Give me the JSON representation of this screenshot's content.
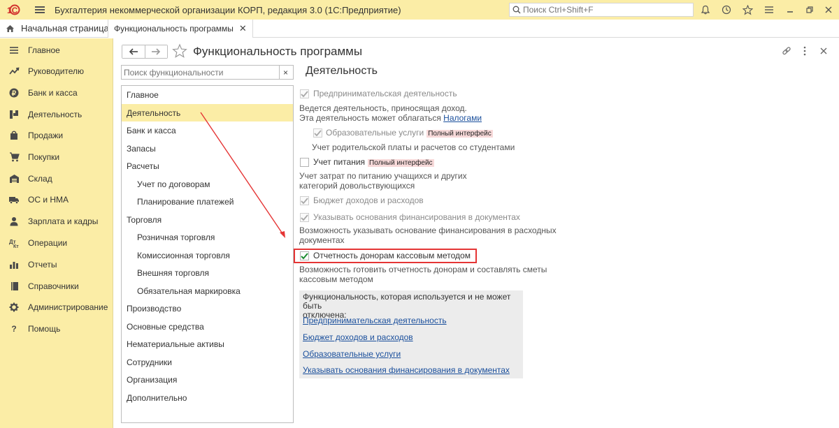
{
  "titlebar": {
    "logo": "1С",
    "app_title": "Бухгалтерия некоммерческой организации КОРП, редакция 3.0  (1С:Предприятие)",
    "search_placeholder": "Поиск Ctrl+Shift+F",
    "icons": [
      "bell-icon",
      "history-icon",
      "star-icon",
      "menu-lines-icon",
      "minimize-icon",
      "restore-icon",
      "close-icon"
    ]
  },
  "tabs": {
    "home_label": "Начальная страница",
    "active_label": "Функциональность программы"
  },
  "sidebar": {
    "items": [
      {
        "label": "Главное",
        "icon": "menu-icon"
      },
      {
        "label": "Руководителю",
        "icon": "trend-icon"
      },
      {
        "label": "Банк и касса",
        "icon": "ruble-icon"
      },
      {
        "label": "Деятельность",
        "icon": "activity-icon"
      },
      {
        "label": "Продажи",
        "icon": "bag-icon"
      },
      {
        "label": "Покупки",
        "icon": "cart-icon"
      },
      {
        "label": "Склад",
        "icon": "warehouse-icon"
      },
      {
        "label": "ОС и НМА",
        "icon": "truck-icon"
      },
      {
        "label": "Зарплата и кадры",
        "icon": "person-icon"
      },
      {
        "label": "Операции",
        "icon": "operations-icon"
      },
      {
        "label": "Отчеты",
        "icon": "bar-chart-icon"
      },
      {
        "label": "Справочники",
        "icon": "book-icon"
      },
      {
        "label": "Администрирование",
        "icon": "gear-icon"
      },
      {
        "label": "Помощь",
        "icon": "question-icon"
      }
    ]
  },
  "header": {
    "title": "Функциональность программы"
  },
  "left_panel": {
    "search_placeholder": "Поиск функциональности",
    "clear_label": "×",
    "sections": [
      {
        "label": "Главное",
        "indent": 0
      },
      {
        "label": "Деятельность",
        "indent": 0,
        "selected": true
      },
      {
        "label": "Банк и касса",
        "indent": 0
      },
      {
        "label": "Запасы",
        "indent": 0
      },
      {
        "label": "Расчеты",
        "indent": 0
      },
      {
        "label": "Учет по договорам",
        "indent": 1
      },
      {
        "label": "Планирование платежей",
        "indent": 1
      },
      {
        "label": "Торговля",
        "indent": 0
      },
      {
        "label": "Розничная торговля",
        "indent": 1
      },
      {
        "label": "Комиссионная торговля",
        "indent": 1
      },
      {
        "label": "Внешняя торговля",
        "indent": 1
      },
      {
        "label": "Обязательная маркировка",
        "indent": 1
      },
      {
        "label": "Производство",
        "indent": 0
      },
      {
        "label": "Основные средства",
        "indent": 0
      },
      {
        "label": "Нематериальные активы",
        "indent": 0
      },
      {
        "label": "Сотрудники",
        "indent": 0
      },
      {
        "label": "Организация",
        "indent": 0
      },
      {
        "label": "Дополнительно",
        "indent": 0
      }
    ]
  },
  "content": {
    "section_title": "Деятельность",
    "entrepreneurial": {
      "label": "Предпринимательская деятельность",
      "checked": true,
      "desc1": "Ведется деятельность, приносящая доход.",
      "desc2_prefix": "Эта деятельность может облагаться ",
      "desc2_link": "Налогами"
    },
    "educational": {
      "label": "Образовательные услуги",
      "badge": "Полный интерфейс",
      "checked": true,
      "desc": "Учет родительской платы и расчетов со студентами"
    },
    "meals": {
      "label": "Учет питания",
      "badge": "Полный интерфейс",
      "checked": false,
      "desc1": "Учет затрат по питанию учащихся и других",
      "desc2": "категорий довольствующихся"
    },
    "budget": {
      "label": "Бюджет доходов и расходов",
      "checked": true
    },
    "funding": {
      "label": "Указывать основания финансирования в документах",
      "checked": true,
      "desc1": "Возможность указывать основание финансирования в расходных",
      "desc2": "документах"
    },
    "donors": {
      "label": "Отчетность донорам кассовым методом",
      "checked": true,
      "desc1": "Возможность готовить отчетность донорам и составлять сметы",
      "desc2": "кассовым методом"
    },
    "infobox": {
      "text1": "Функциональность, которая используется и не может быть",
      "text2": "отключена:",
      "links": [
        "Предпринимательская деятельность",
        "Бюджет доходов и расходов",
        "Образовательные услуги",
        "Указывать основания финансирования в документах"
      ]
    }
  },
  "colors": {
    "sidebar_bg": "#fbeda6",
    "selected_bg": "#fbeda6",
    "link": "#1a4f9c",
    "highlight_border": "#e53535",
    "badge_bg": "#f7d9d9",
    "checkmark": "#1a8a2e"
  }
}
